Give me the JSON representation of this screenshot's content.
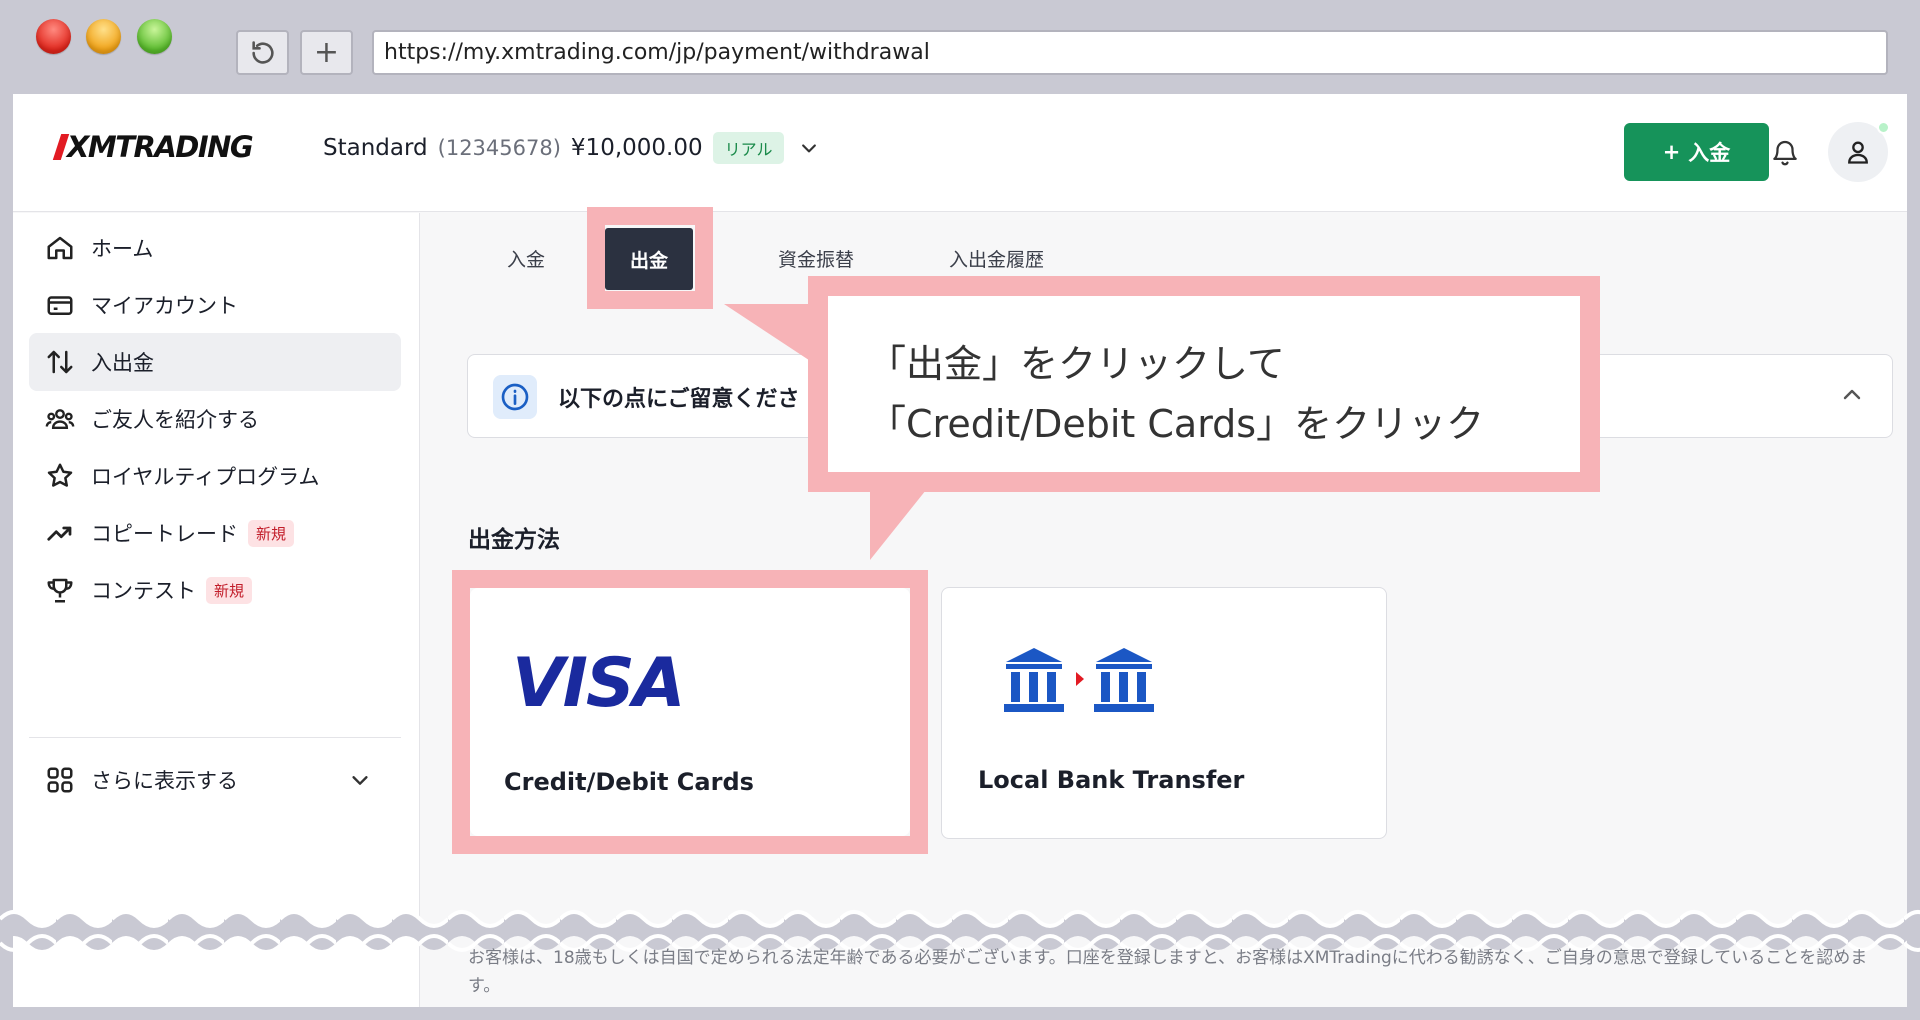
{
  "browser": {
    "url": "https://my.xmtrading.com/jp/payment/withdrawal",
    "reload_icon": "reload-icon",
    "newtab_label": "+"
  },
  "header": {
    "logo": "XMTRADING",
    "account_type": "Standard",
    "account_number": "(12345678)",
    "balance": "¥10,000.00",
    "account_badge": "リアル",
    "deposit_label": "入金",
    "deposit_plus": "+"
  },
  "sidebar": {
    "items": [
      {
        "label": "ホーム",
        "icon": "home-icon"
      },
      {
        "label": "マイアカウント",
        "icon": "card-icon"
      },
      {
        "label": "入出金",
        "icon": "transfer-arrows-icon"
      },
      {
        "label": "ご友人を紹介する",
        "icon": "people-icon"
      },
      {
        "label": "ロイヤルティプログラム",
        "icon": "star-icon"
      },
      {
        "label": "コピートレード",
        "icon": "trend-up-icon",
        "badge": "新規"
      },
      {
        "label": "コンテスト",
        "icon": "trophy-icon",
        "badge": "新規"
      }
    ],
    "more_label": "さらに表示する"
  },
  "tabs": [
    "入金",
    "出金",
    "資金振替",
    "入出金履歴"
  ],
  "info": {
    "text": "以下の点にご留意くださ"
  },
  "section_title": "出金方法",
  "methods": [
    {
      "label": "Credit/Debit Cards",
      "logo": "VISA"
    },
    {
      "label": "Local Bank Transfer",
      "logo": "bank-transfer-icon"
    }
  ],
  "callout": {
    "line1": "「出金」をクリックして",
    "line2": "「Credit/Debit Cards」をクリック"
  },
  "footer": {
    "note": "お客様は、18歳もしくは自国で定められる法定年齢である必要がございます。口座を登録しますと、お客様はXMTradingに代わる勧誘なく、ご自身の意思で登録していることを認めます。"
  },
  "colors": {
    "accent_green": "#16935a",
    "highlight_pink": "#f7b3b7",
    "active_tab": "#2b3140",
    "visa_blue": "#1a2a9e"
  }
}
